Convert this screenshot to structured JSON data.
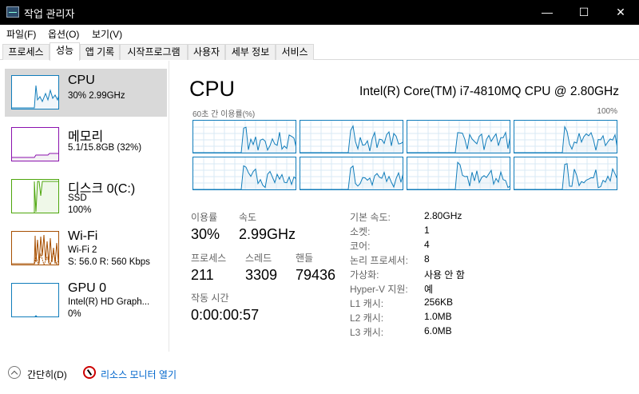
{
  "window": {
    "title": "작업 관리자",
    "minimize": "—",
    "maximize": "☐",
    "close": "✕"
  },
  "menu": [
    "파일(F)",
    "옵션(O)",
    "보기(V)"
  ],
  "tabs": [
    "프로세스",
    "성능",
    "앱 기록",
    "시작프로그램",
    "사용자",
    "세부 정보",
    "서비스"
  ],
  "sidebar": {
    "items": [
      {
        "title": "CPU",
        "lines": [
          "30% 2.99GHz"
        ],
        "color": "#117dbb"
      },
      {
        "title": "메모리",
        "lines": [
          "5.1/15.8GB (32%)"
        ],
        "color": "#8b12ae"
      },
      {
        "title": "디스크 0(C:)",
        "lines": [
          "SSD",
          "100%"
        ],
        "color": "#4da60c"
      },
      {
        "title": "Wi-Fi",
        "lines": [
          "Wi-Fi 2",
          "S: 56.0  R: 560 Kbps"
        ],
        "color": "#a74f01"
      },
      {
        "title": "GPU 0",
        "lines": [
          "Intel(R) HD Graph...",
          "0%"
        ],
        "color": "#117dbb"
      }
    ]
  },
  "cpu": {
    "heading": "CPU",
    "model": "Intel(R) Core(TM) i7-4810MQ CPU @ 2.80GHz",
    "graph_left_label": "60초 간 이용률(%)",
    "graph_right_label": "100%",
    "stats": {
      "util_label": "이용률",
      "util_value": "30%",
      "speed_label": "속도",
      "speed_value": "2.99GHz",
      "proc_label": "프로세스",
      "proc_value": "211",
      "thread_label": "스레드",
      "thread_value": "3309",
      "handle_label": "핸들",
      "handle_value": "79436",
      "uptime_label": "작동 시간",
      "uptime_value": "0:00:00:57"
    },
    "info": [
      {
        "label": "기본 속도:",
        "value": "2.80GHz"
      },
      {
        "label": "소켓:",
        "value": "1"
      },
      {
        "label": "코어:",
        "value": "4"
      },
      {
        "label": "논리 프로세서:",
        "value": "8"
      },
      {
        "label": "가상화:",
        "value": "사용 안 함"
      },
      {
        "label": "Hyper-V 지원:",
        "value": "예"
      },
      {
        "label": "L1 캐시:",
        "value": "256KB"
      },
      {
        "label": "L2 캐시:",
        "value": "1.0MB"
      },
      {
        "label": "L3 캐시:",
        "value": "6.0MB"
      }
    ]
  },
  "bottom": {
    "less_details": "간단히(D)",
    "resource_monitor": "리소스 모니터 열기"
  },
  "colors": {
    "cpu": "#117dbb",
    "grid": "#d9eaf4"
  }
}
